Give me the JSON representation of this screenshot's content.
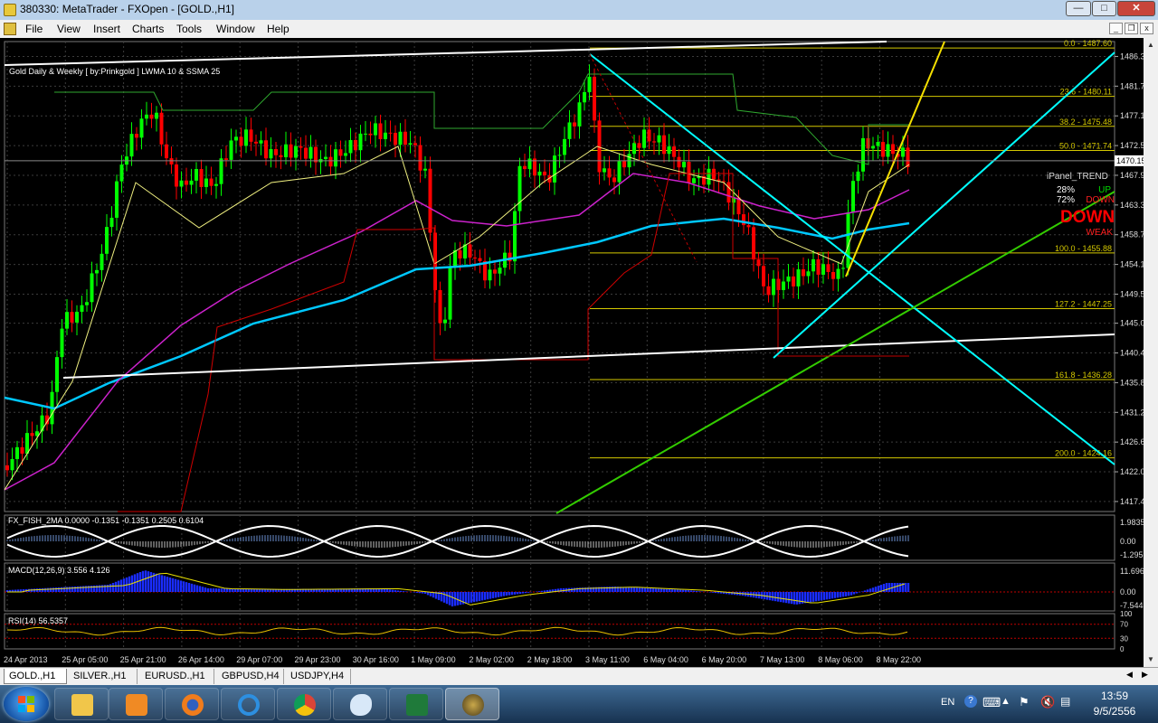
{
  "window": {
    "title": "380330: MetaTrader - FXOpen - [GOLD.,H1]"
  },
  "menu": [
    "File",
    "View",
    "Insert",
    "Charts",
    "Tools",
    "Window",
    "Help"
  ],
  "chart": {
    "label": "Gold Daily & Weekly [ by:Prinkgold ] LWMA 10  &  SSMA 25",
    "current_price": "1470.15",
    "price_ticks": [
      "1486.30",
      "1481.70",
      "1477.10",
      "1472.50",
      "1467.90",
      "1463.30",
      "1458.70",
      "1454.10",
      "1449.50",
      "1445.00",
      "1440.40",
      "1435.80",
      "1431.20",
      "1426.60",
      "1422.00",
      "1417.40"
    ],
    "date_ticks": [
      "24 Apr 2013",
      "25 Apr 05:00",
      "25 Apr 21:00",
      "26 Apr 14:00",
      "29 Apr 07:00",
      "29 Apr 23:00",
      "30 Apr 16:00",
      "1 May 09:00",
      "2 May 02:00",
      "2 May 18:00",
      "3 May 11:00",
      "6 May 04:00",
      "6 May 20:00",
      "7 May 13:00",
      "8 May 06:00",
      "8 May 22:00"
    ],
    "fib_levels": [
      {
        "level": "0.0",
        "price": "1487.60"
      },
      {
        "level": "23.6",
        "price": "1480.11"
      },
      {
        "level": "38.2",
        "price": "1475.48"
      },
      {
        "level": "50.0",
        "price": "1471.74"
      },
      {
        "level": "100.0",
        "price": "1455.88"
      },
      {
        "level": "127.2",
        "price": "1447.25"
      },
      {
        "level": "161.8",
        "price": "1436.28"
      },
      {
        "level": "200.0",
        "price": "1424.16"
      }
    ],
    "ipanel": {
      "title": "iPanel_TREND",
      "up_pct": "28%",
      "down_pct": "72%",
      "up": "UP",
      "down": "DOWN",
      "big": "DOWN",
      "strength": "WEAK"
    }
  },
  "fisher": {
    "label": "FX_FISH_2MA 0.0000 -0.1351 -0.1351 0.2505 0.6104",
    "ticks": [
      "1.9835",
      "0.00",
      "-1.295"
    ]
  },
  "macd": {
    "label": "MACD(12,26,9) 3.556 4.126",
    "ticks": [
      "11.696",
      "0.00",
      "-7.544"
    ]
  },
  "rsi": {
    "label": "RSI(14) 56.5357",
    "ticks": [
      "100",
      "70",
      "30",
      "0"
    ]
  },
  "tabs": [
    "GOLD.,H1",
    "SILVER.,H1",
    "EURUSD.,H1",
    "GBPUSD,H4",
    "USDJPY,H4"
  ],
  "tray": {
    "lang": "EN",
    "time": "13:59",
    "date": "9/5/2556"
  },
  "colors": {
    "bull": "#00ff00",
    "bear": "#ff0000",
    "fib": "#d4c800",
    "trend_cyan": "#00ffff",
    "trend_green": "#33cc00",
    "ssma": "#00c8ff",
    "lwma": "#cc22cc",
    "chart_bg": "#000000",
    "grid": "#3c3c3c"
  }
}
